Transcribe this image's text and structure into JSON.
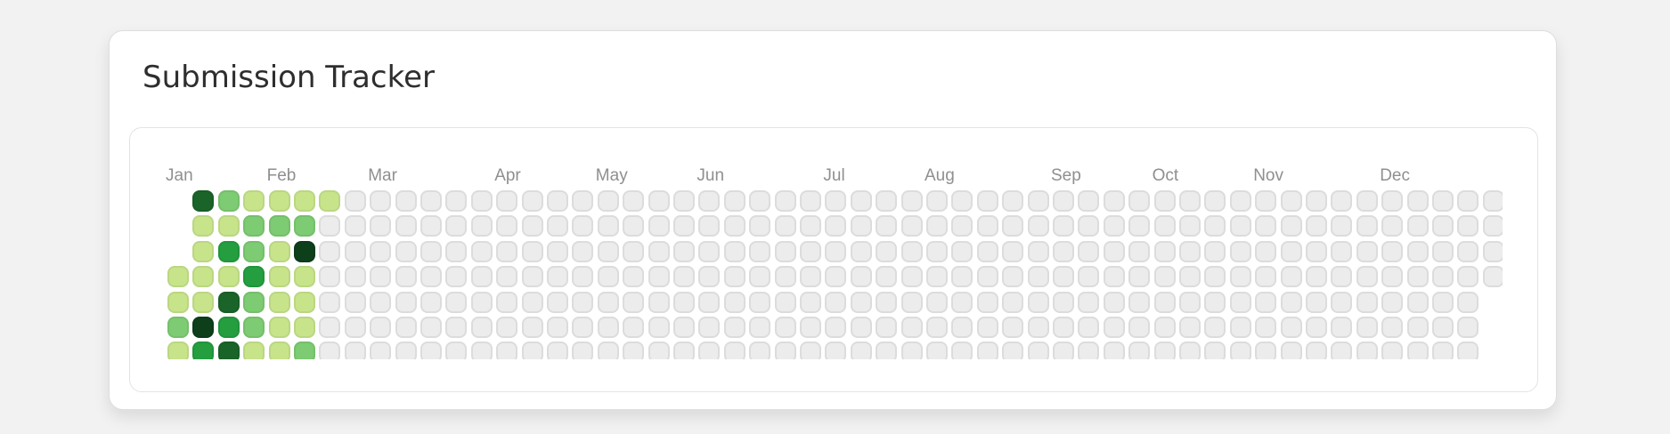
{
  "title": "Submission Tracker",
  "months": [
    {
      "label": "Jan",
      "week": 0
    },
    {
      "label": "Feb",
      "week": 4
    },
    {
      "label": "Mar",
      "week": 8
    },
    {
      "label": "Apr",
      "week": 13
    },
    {
      "label": "May",
      "week": 17
    },
    {
      "label": "Jun",
      "week": 21
    },
    {
      "label": "Jul",
      "week": 26
    },
    {
      "label": "Aug",
      "week": 30
    },
    {
      "label": "Sep",
      "week": 35
    },
    {
      "label": "Oct",
      "week": 39
    },
    {
      "label": "Nov",
      "week": 43
    },
    {
      "label": "Dec",
      "week": 48
    }
  ],
  "colors": {
    "0": "#ececec",
    "1": "#c7e48b",
    "2": "#7dcb72",
    "3": "#249e3f",
    "4": "#1a6429",
    "5": "#0d3f1b"
  },
  "weeks_total": 53,
  "first_week_start_day": 3,
  "last_week_end_day": 3,
  "levels_by_week": [
    [
      0,
      0,
      0,
      1,
      1,
      2,
      1
    ],
    [
      4,
      1,
      1,
      1,
      1,
      5,
      3
    ],
    [
      2,
      1,
      3,
      1,
      4,
      3,
      4
    ],
    [
      1,
      2,
      2,
      3,
      2,
      2,
      1
    ],
    [
      1,
      2,
      1,
      1,
      1,
      1,
      1
    ],
    [
      1,
      2,
      5,
      1,
      1,
      1,
      2
    ],
    [
      1
    ]
  ]
}
